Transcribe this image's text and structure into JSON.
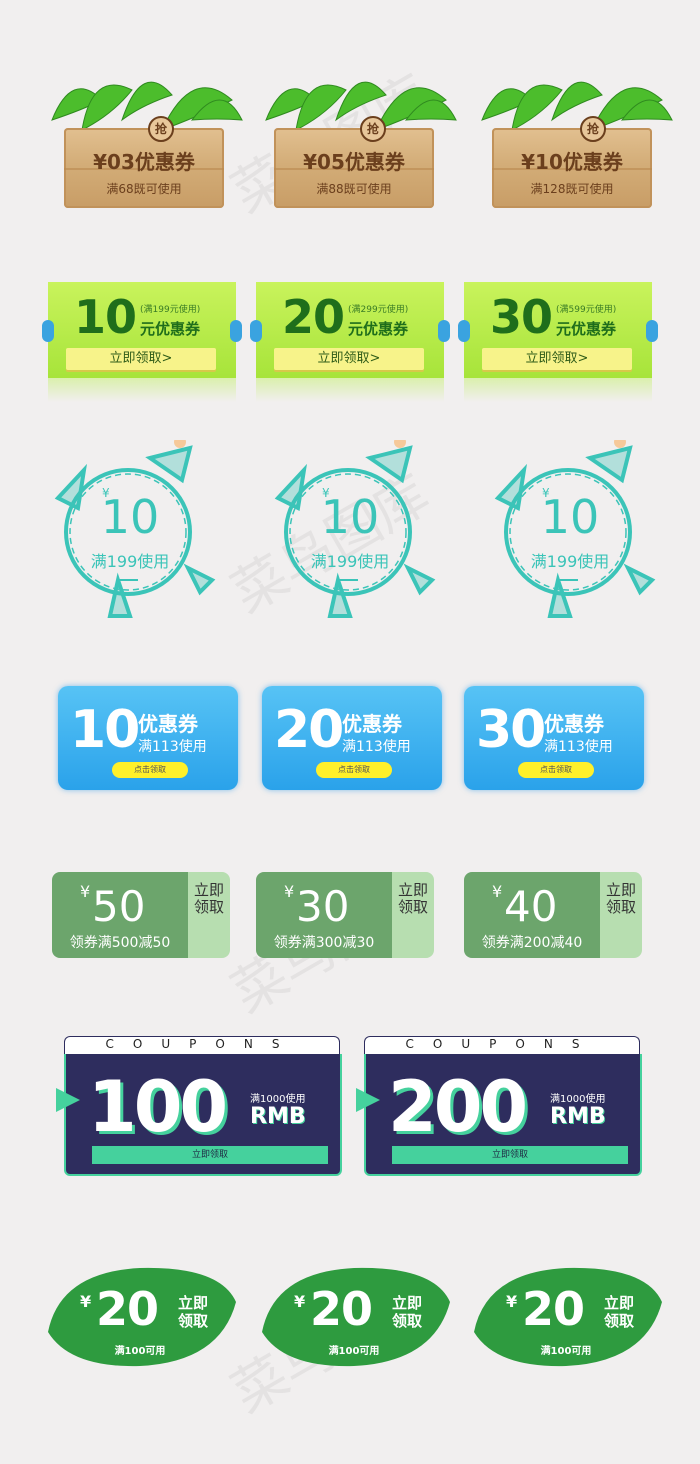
{
  "row1": [
    {
      "title": "¥03优惠券",
      "sub": "满68既可使用",
      "badge": "抢"
    },
    {
      "title": "¥05优惠券",
      "sub": "满88既可使用",
      "badge": "抢"
    },
    {
      "title": "¥10优惠券",
      "sub": "满128既可使用",
      "badge": "抢"
    }
  ],
  "row2": [
    {
      "value": "10",
      "cond": "(满199元使用)",
      "label": "元优惠券",
      "button": "立即领取>"
    },
    {
      "value": "20",
      "cond": "(满299元使用)",
      "label": "元优惠券",
      "button": "立即领取>"
    },
    {
      "value": "30",
      "cond": "(满599元使用)",
      "label": "元优惠券",
      "button": "立即领取>"
    }
  ],
  "row3": [
    {
      "currency": "¥",
      "value": "10",
      "cond": "满199使用"
    },
    {
      "currency": "¥",
      "value": "10",
      "cond": "满199使用"
    },
    {
      "currency": "¥",
      "value": "10",
      "cond": "满199使用"
    }
  ],
  "row4": [
    {
      "value": "10",
      "label": "优惠券",
      "cond": "满113使用",
      "button": "点击领取"
    },
    {
      "value": "20",
      "label": "优惠券",
      "cond": "满113使用",
      "button": "点击领取"
    },
    {
      "value": "30",
      "label": "优惠券",
      "cond": "满113使用",
      "button": "点击领取"
    }
  ],
  "row5": [
    {
      "currency": "¥",
      "value": "50",
      "cond": "领券满500减50",
      "action": "立即领取"
    },
    {
      "currency": "¥",
      "value": "30",
      "cond": "领券满300减30",
      "action": "立即领取"
    },
    {
      "currency": "¥",
      "value": "40",
      "cond": "领券满200减40",
      "action": "立即领取"
    }
  ],
  "row6": [
    {
      "header": "COUPONS",
      "value": "100",
      "cond": "满1000使用",
      "unit": "RMB",
      "button": "立即领取"
    },
    {
      "header": "COUPONS",
      "value": "200",
      "cond": "满1000使用",
      "unit": "RMB",
      "button": "立即领取"
    }
  ],
  "row7": [
    {
      "currency": "¥",
      "value": "20",
      "action": "立即领取",
      "cond": "满100可用"
    },
    {
      "currency": "¥",
      "value": "20",
      "action": "立即领取",
      "cond": "满100可用"
    },
    {
      "currency": "¥",
      "value": "20",
      "action": "立即领取",
      "cond": "满100可用"
    }
  ],
  "watermark": "菜鸟图库",
  "colors": {
    "background": "#f1efef",
    "wood": "#d3ad78",
    "lime": "#a7e43a",
    "teal": "#3bc4b8",
    "blue": "#2aa2ea",
    "stamp_green": "#6ca56c",
    "navy": "#2e2d5e",
    "mint": "#45d19d",
    "leaf_green": "#2e9b3f"
  }
}
